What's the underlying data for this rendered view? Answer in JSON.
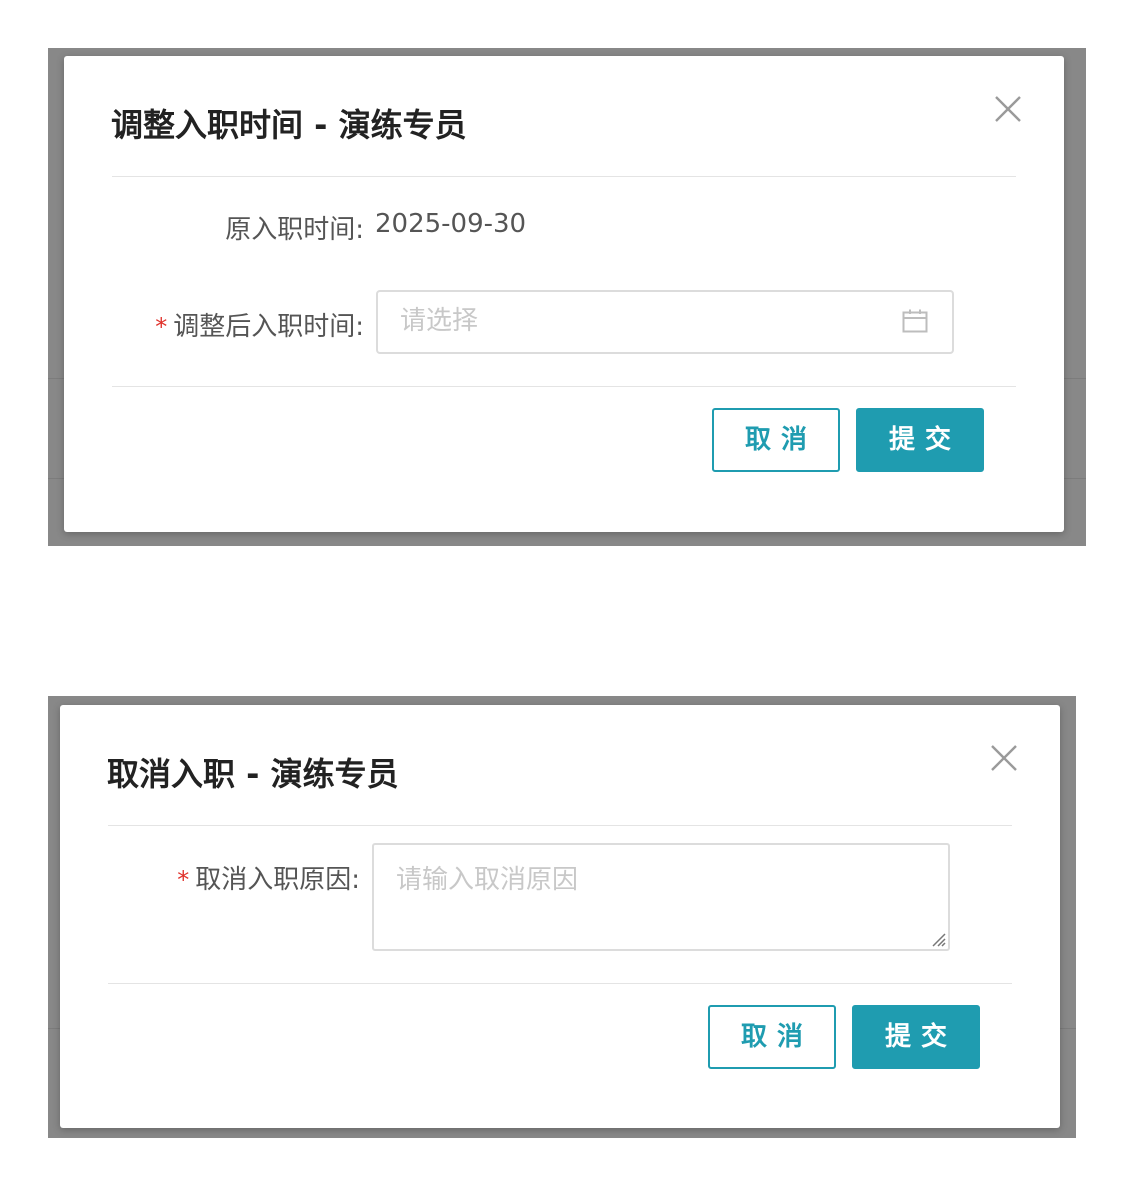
{
  "dialog1": {
    "title": "调整入职时间 - 演练专员",
    "original_label": "原入职时间:",
    "original_value": "2025-09-30",
    "required_mark": "*",
    "new_label": "调整后入职时间:",
    "new_placeholder": "请选择",
    "cancel_label": "取消",
    "submit_label": "提交"
  },
  "dialog2": {
    "title": "取消入职 - 演练专员",
    "required_mark": "*",
    "reason_label": "取消入职原因:",
    "reason_placeholder": "请输入取消原因",
    "cancel_label": "取消",
    "submit_label": "提交"
  },
  "icons": {
    "close": "close-icon",
    "calendar": "calendar-icon",
    "resize": "resize-handle-icon"
  },
  "colors": {
    "accent": "#1f9cb0",
    "required": "#e0322b",
    "overlay": "#888888",
    "placeholder": "#c8c8c8"
  }
}
